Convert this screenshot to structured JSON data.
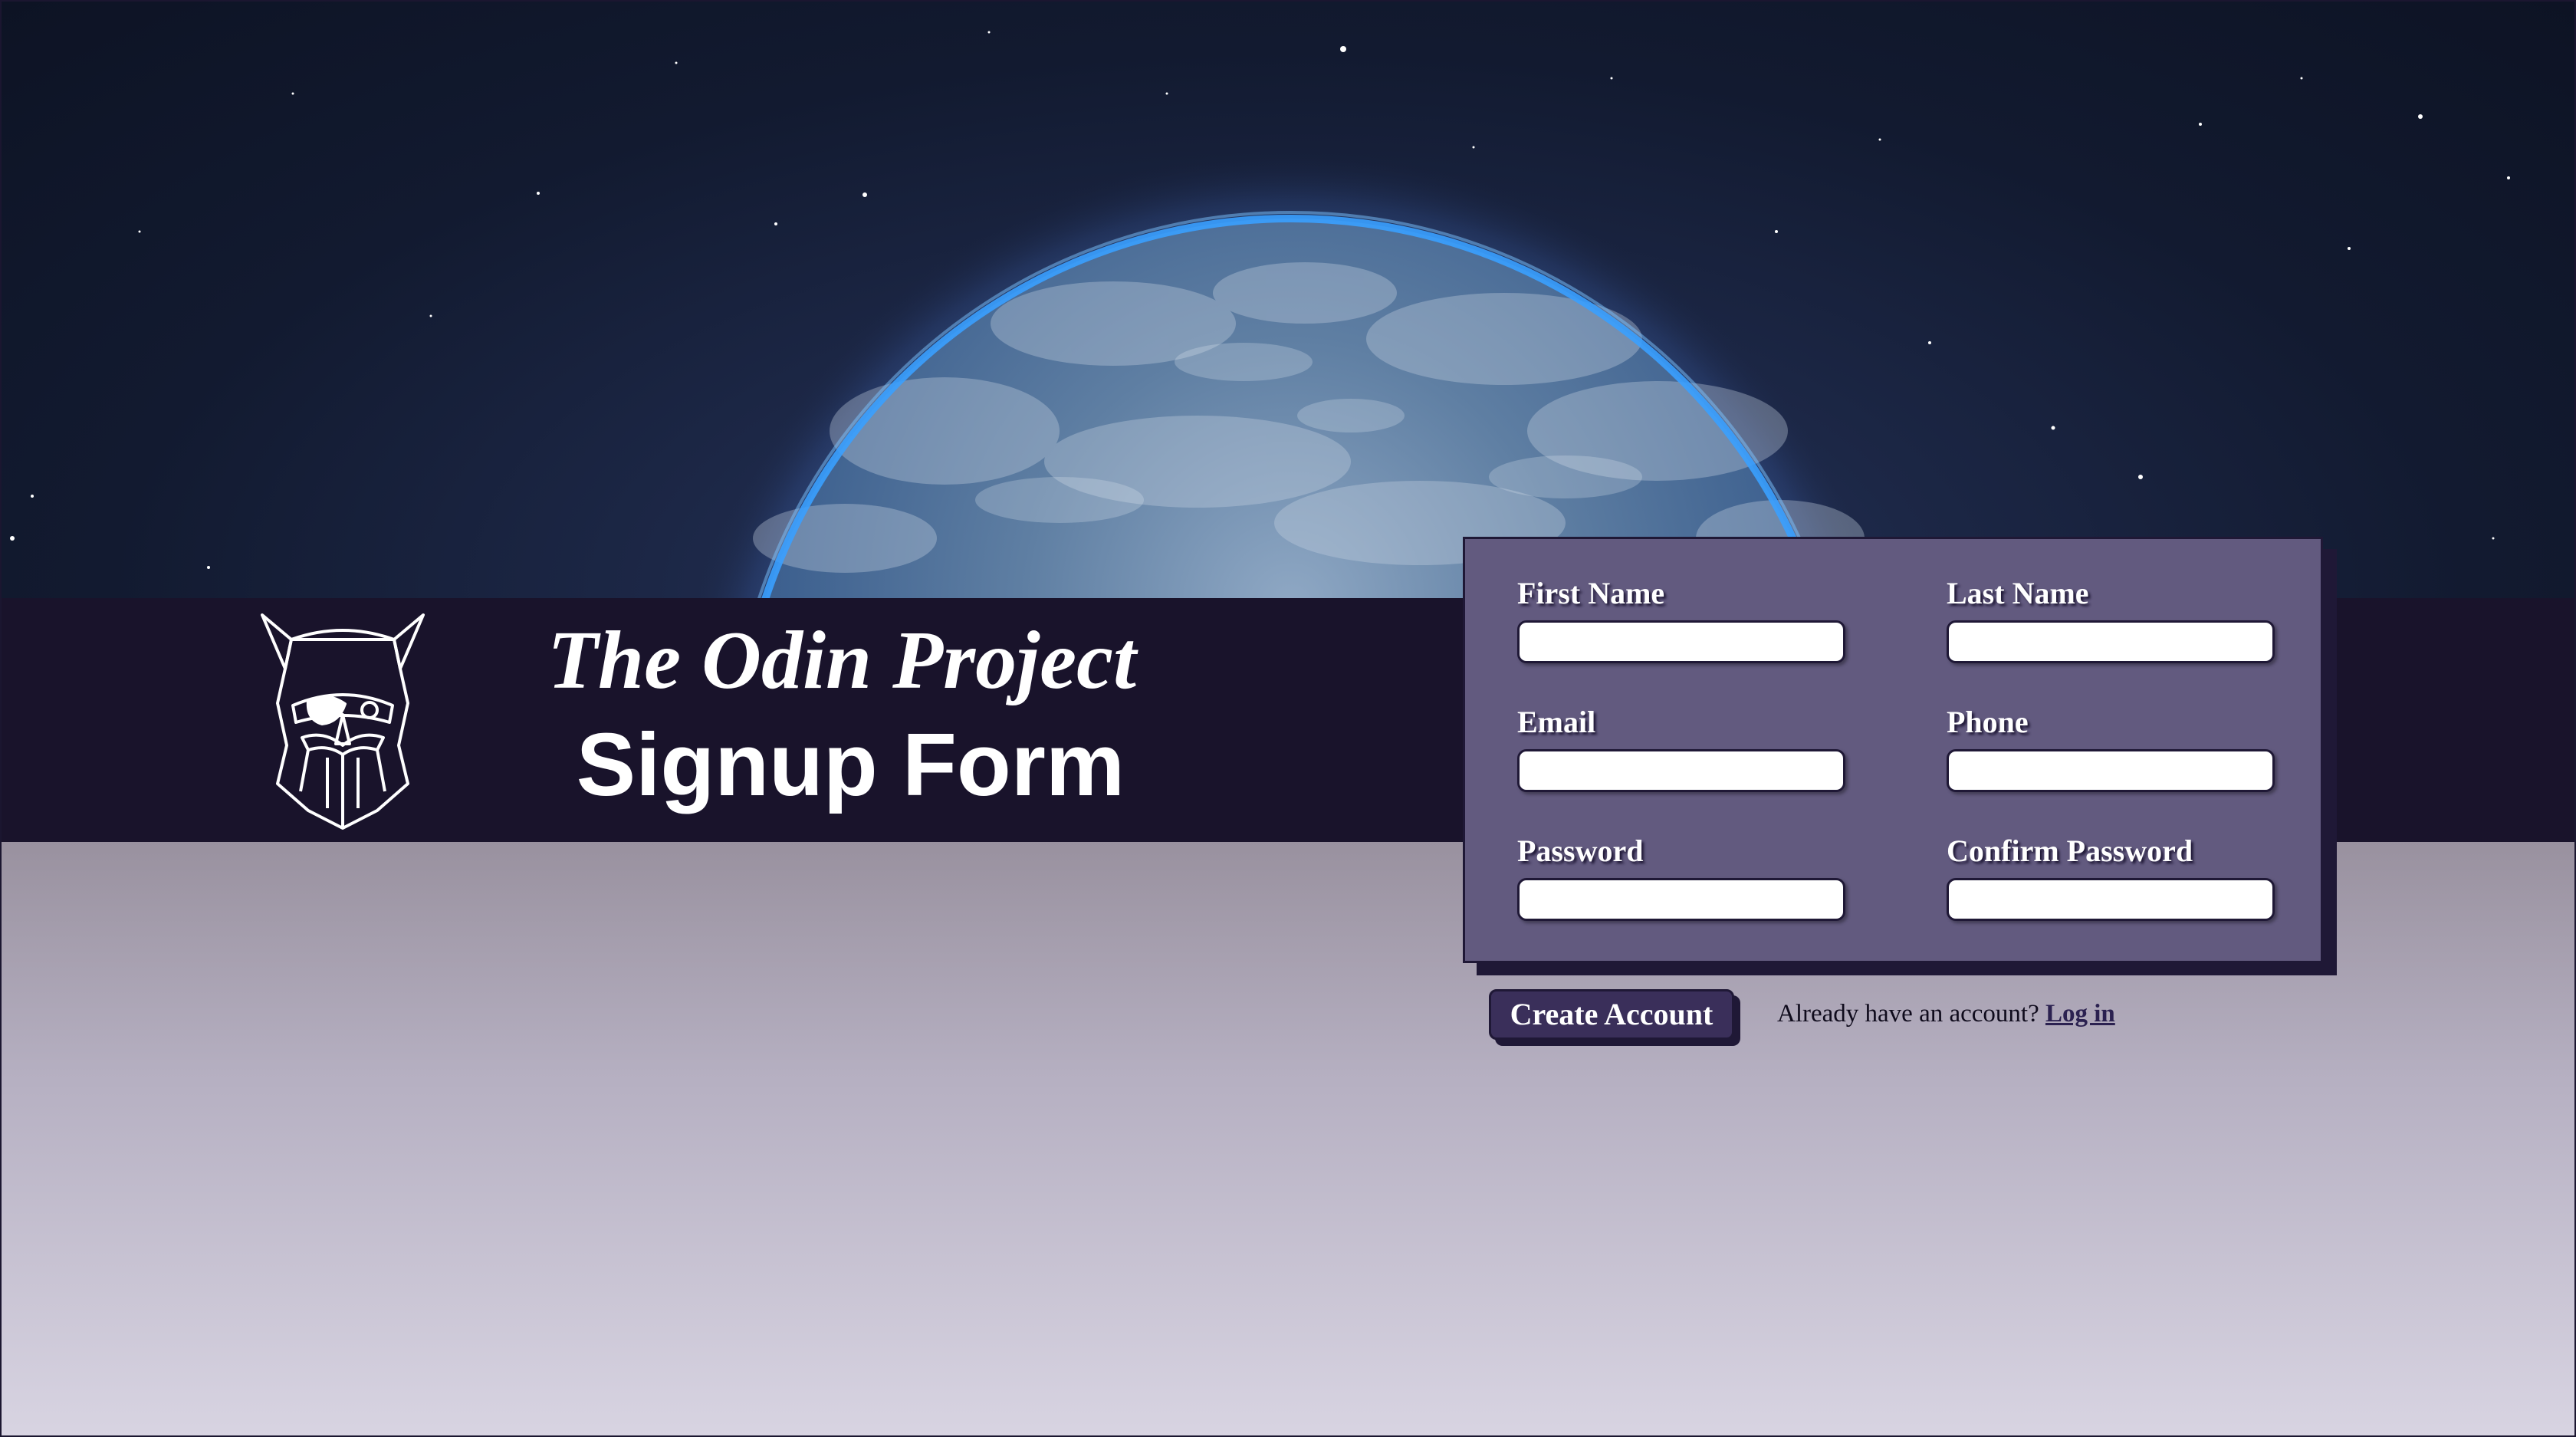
{
  "header": {
    "brand_name": "The Odin Project",
    "page_title": "Signup Form"
  },
  "form": {
    "fields": [
      {
        "label": "First Name",
        "value": ""
      },
      {
        "label": "Last Name",
        "value": ""
      },
      {
        "label": "Email",
        "value": ""
      },
      {
        "label": "Phone",
        "value": ""
      },
      {
        "label": "Password",
        "value": ""
      },
      {
        "label": "Confirm Password",
        "value": ""
      }
    ]
  },
  "actions": {
    "create_account_label": "Create Account",
    "login_prompt": "Already have an account?",
    "login_link_label": "Log in"
  },
  "colors": {
    "banner": "#19132b",
    "form_card": "#625a7f",
    "card_border": "#1f1836",
    "button": "#3a2f5a",
    "planet_glow": "#3aa0ff"
  },
  "icons": {
    "logo": "odin-viking-head-icon"
  }
}
